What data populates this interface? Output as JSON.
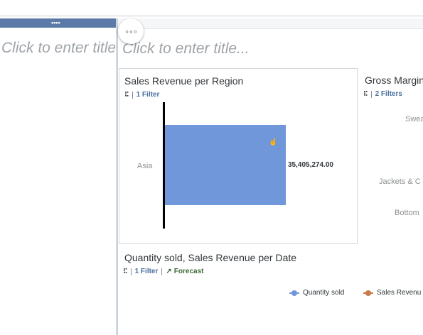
{
  "left_panel": {
    "handle": "••••",
    "title": "Click to enter title..."
  },
  "header": {
    "more_button": "∘∘∘",
    "title": "Click to enter title..."
  },
  "sales_card": {
    "title": "Sales Revenue per Region",
    "filter_icon": "hierarchy-icon",
    "filter_label": "1 Filter",
    "chart_data": {
      "type": "bar",
      "orientation": "horizontal",
      "title": "Sales Revenue per Region",
      "categories": [
        "Asia"
      ],
      "values": [
        35405274.0
      ],
      "data_labels": [
        "35,405,274.00"
      ]
    }
  },
  "gross_card": {
    "title": "Gross Margin",
    "filter_label": "2 Filters",
    "categories": [
      "Swea",
      "Jackets & C",
      "Bottom"
    ]
  },
  "quantity_card": {
    "title": "Quantity sold, Sales Revenue per Date",
    "filter_label": "1 Filter",
    "forecast_label": "Forecast",
    "forecast_icon": "arrow-up-right-icon",
    "legend": [
      {
        "label": "Quantity sold",
        "color": "#6f97d9"
      },
      {
        "label": "Sales Revenu",
        "color": "#c87a4a"
      }
    ]
  }
}
